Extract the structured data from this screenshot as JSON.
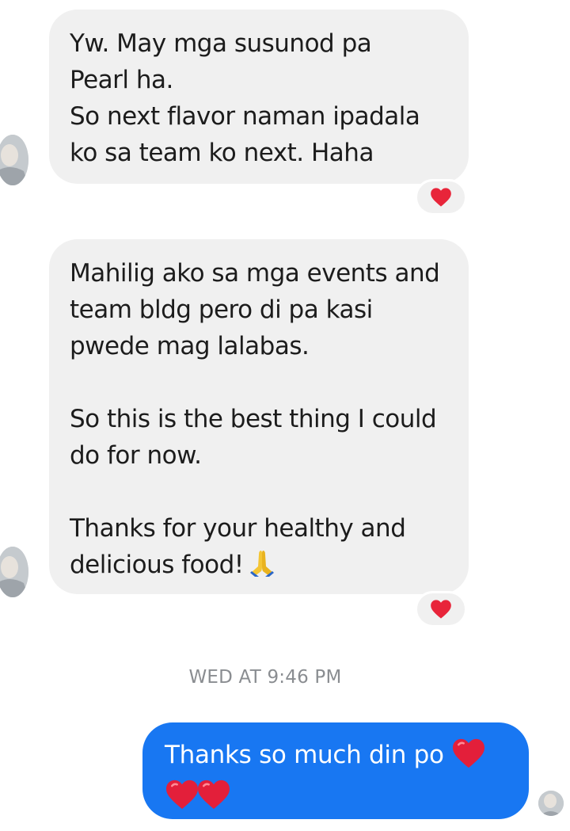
{
  "messages": {
    "incoming_1": {
      "text": "Yw. May mga susunod pa\nPearl ha.\nSo next flavor naman ipadala\nko sa team ko next. Haha"
    },
    "incoming_2": {
      "paragraph_1": "Mahilig ako sa mga events and\nteam bldg pero di pa kasi\npwede mag lalabas.",
      "paragraph_2": "So this is the best thing I could\ndo for now.",
      "paragraph_3": "Thanks for your healthy and\ndelicious food!"
    },
    "timestamp": "WED AT 9:46 PM",
    "outgoing_1": {
      "text": "Thanks so much din po"
    }
  },
  "icons": {
    "reaction": "red-heart-icon",
    "prayer": "folded-hands-icon",
    "avatar": "contact-avatar"
  },
  "colors": {
    "incoming_bubble": "#f0f0f0",
    "outgoing_bubble": "#1877f2",
    "heart": "#e8253a",
    "timestamp": "#8a8d91"
  }
}
